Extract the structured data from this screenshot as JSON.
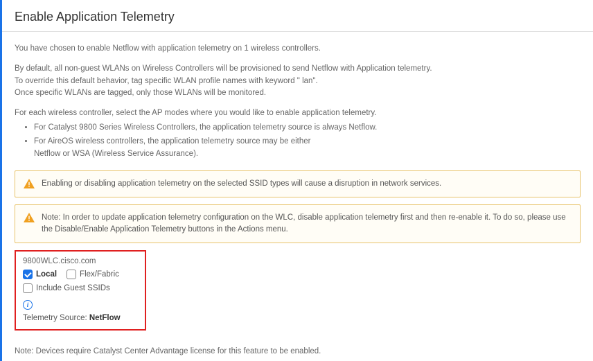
{
  "header": {
    "title": "Enable Application Telemetry"
  },
  "intro": "You have chosen to enable Netflow with application telemetry on 1 wireless controllers.",
  "defaults": {
    "line1": "By default, all non-guest WLANs on Wireless Controllers will be provisioned to send Netflow with Application telemetry.",
    "line2": "To override this default behavior, tag specific WLAN profile names with keyword \" lan\".",
    "line3": "Once specific WLANs are tagged, only those WLANs will be monitored."
  },
  "instruction": "For each wireless controller, select the AP modes where you would like to enable application telemetry.",
  "bullets": {
    "b1": "For Catalyst 9800 Series Wireless Controllers, the application telemetry source is always Netflow.",
    "b2a": "For AireOS wireless controllers, the application telemetry source may be either",
    "b2b": "Netflow or WSA (Wireless Service Assurance)."
  },
  "warnings": {
    "w1": "Enabling or disabling application telemetry on the selected SSID types will cause a disruption in network services.",
    "w2": "Note: In order to update application telemetry configuration on the WLC, disable application telemetry first and then re-enable it. To do so, please use the Disable/Enable Application Telemetry buttons in the Actions menu."
  },
  "device": {
    "name": "9800WLC.cisco.com",
    "local_label": "Local",
    "flex_label": "Flex/Fabric",
    "guest_label": "Include Guest SSIDs",
    "source_label": "Telemetry Source: ",
    "source_value": "NetFlow",
    "local_checked": true,
    "flex_checked": false,
    "guest_checked": false
  },
  "footer_note": "Note: Devices require Catalyst Center Advantage license for this feature to be enabled."
}
